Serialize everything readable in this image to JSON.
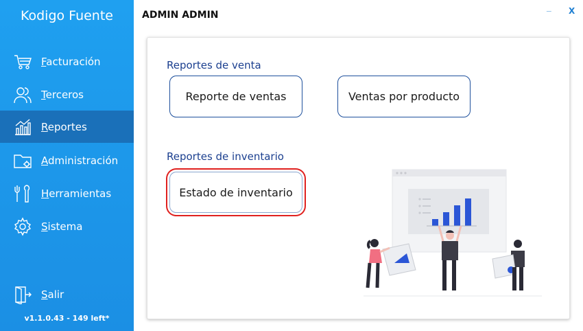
{
  "app": {
    "title": "Kodigo Fuente",
    "version": "v1.1.0.43 - 149 left*"
  },
  "sidebar": {
    "items": [
      {
        "label": "Facturación",
        "icon": "cart-icon"
      },
      {
        "label": "Terceros",
        "icon": "users-icon"
      },
      {
        "label": "Reportes",
        "icon": "chart-icon",
        "active": true
      },
      {
        "label": "Administración",
        "icon": "folder-settings-icon"
      },
      {
        "label": "Herramientas",
        "icon": "tools-icon"
      },
      {
        "label": "Sistema",
        "icon": "gear-icon"
      }
    ],
    "logout": {
      "label": "Salir",
      "icon": "exit-door-icon"
    }
  },
  "header": {
    "title": "ADMIN ADMIN",
    "minimize": "_",
    "close": "X"
  },
  "main": {
    "sales_section": {
      "title": "Reportes de venta",
      "buttons": [
        "Reporte de ventas",
        "Ventas por producto"
      ]
    },
    "inventory_section": {
      "title": "Reportes de inventario",
      "buttons": [
        "Estado de inventario"
      ]
    }
  },
  "colors": {
    "sidebar": "#1b95e8",
    "sidebar_active": "#1a70b9",
    "section_title": "#1b3f8f",
    "button_border": "#1d4f9c",
    "focus_ring": "#e0201e"
  }
}
